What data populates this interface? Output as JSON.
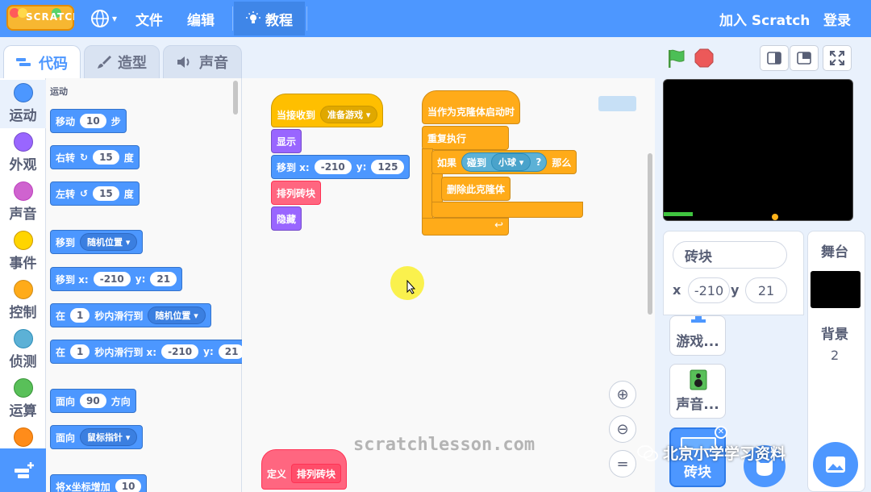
{
  "menubar": {
    "logo_text": "SCRATCH",
    "file": "文件",
    "edit": "编辑",
    "tutorials": "教程",
    "join": "加入 Scratch",
    "login": "登录"
  },
  "tabs": {
    "code": "代码",
    "costumes": "造型",
    "sounds": "声音"
  },
  "categories": [
    {
      "label": "运动",
      "color": "#4c97ff"
    },
    {
      "label": "外观",
      "color": "#9966ff"
    },
    {
      "label": "声音",
      "color": "#cf63cf"
    },
    {
      "label": "事件",
      "color": "#ffd500"
    },
    {
      "label": "控制",
      "color": "#ffab19"
    },
    {
      "label": "侦测",
      "color": "#5cb1d6"
    },
    {
      "label": "运算",
      "color": "#59c059"
    },
    {
      "label": "",
      "color": "#ff8c1a"
    }
  ],
  "palette": {
    "section": "运动",
    "move": {
      "label": "移动",
      "value": "10",
      "unit": "步"
    },
    "turn_right": {
      "label": "右转",
      "value": "15",
      "unit": "度"
    },
    "turn_left": {
      "label": "左转",
      "value": "15",
      "unit": "度"
    },
    "goto_random": {
      "label": "移到",
      "option": "随机位置"
    },
    "goto_xy": {
      "label": "移到 x:",
      "x": "-210",
      "ylabel": "y:",
      "y": "21"
    },
    "glide_random": {
      "label": "在",
      "value": "1",
      "mid": "秒内滑行到",
      "option": "随机位置"
    },
    "glide_xy": {
      "label": "在",
      "value": "1",
      "mid": "秒内滑行到 x:",
      "x": "-210",
      "ylabel": "y:",
      "y": "21"
    },
    "point_dir": {
      "label": "面向",
      "value": "90",
      "unit": "方向"
    },
    "point_toward": {
      "label": "面向",
      "option": "鼠标指针"
    },
    "change_x": {
      "label": "将x坐标增加",
      "value": "10"
    }
  },
  "scripts": {
    "s1_hat": {
      "label": "当接收到",
      "option": "准备游戏"
    },
    "s1_show": "显示",
    "s1_goto": {
      "label": "移到 x:",
      "x": "-210",
      "ylabel": "y:",
      "y": "125"
    },
    "s1_arrange": "排列砖块",
    "s1_hide": "隐藏",
    "s2_hat": "当作为克隆体启动时",
    "s2_forever": "重复执行",
    "s2_if": {
      "label": "如果",
      "sense": "碰到",
      "option": "小球",
      "q": "?",
      "then": "那么"
    },
    "s2_delete": "删除此克隆体",
    "def": {
      "label": "定义",
      "name": "排列砖块"
    }
  },
  "watermark": "scratchlesson.com",
  "sprite_info": {
    "name": "砖块",
    "x_label": "x",
    "x": "-210",
    "y_label": "y",
    "y": "21"
  },
  "sprites": [
    {
      "label": "游戏..."
    },
    {
      "label": "声音..."
    },
    {
      "label": "砖块"
    }
  ],
  "stage_panel": {
    "title": "舞台",
    "backdrop_label": "背景",
    "backdrop_count": "2"
  },
  "overlay": {
    "wechat": "北京小学学习资料"
  }
}
